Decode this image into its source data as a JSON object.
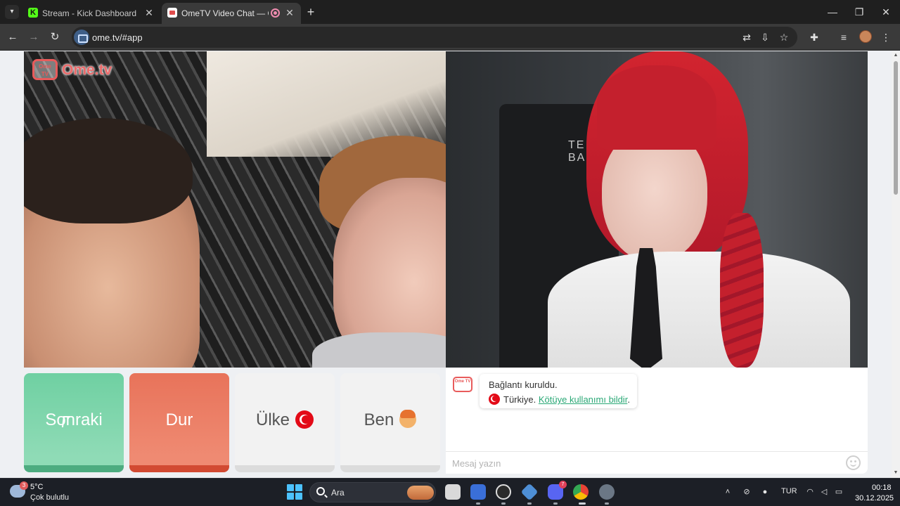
{
  "browser": {
    "tabs": [
      {
        "title": "Stream - Kick Dashboard",
        "favicon": "kick-icon",
        "active": false
      },
      {
        "title": "OmeTV Video Chat — Ome",
        "favicon": "ometv-icon",
        "active": true,
        "recording": true
      }
    ],
    "url": "ome.tv/#app",
    "toolbar_icons": [
      "translate-icon",
      "install-app-icon",
      "bookmark-star-icon",
      "extensions-icon",
      "media-controls-icon",
      "profile-avatar",
      "menu-kebab-icon"
    ]
  },
  "page": {
    "logo": {
      "badge_text": "Ome TV",
      "text": "Ome.tv"
    },
    "remote_chair_text": "TE\nBA",
    "buttons": {
      "next": "Sonraki",
      "stop": "Dur",
      "country": "Ülke",
      "me": "Ben"
    },
    "chat": {
      "logo_text": "Ome TV",
      "message_line1": "Bağlantı kuruldu.",
      "message_country": "Türkiye.",
      "report_link": "Kötüye kullanımı bildir",
      "report_suffix": ".",
      "input_placeholder": "Mesaj yazın",
      "input_value": ""
    },
    "colors": {
      "next_button": "#7dd6ab",
      "stop_button": "#eb7e66",
      "neutral_button": "#f2f2f2",
      "link": "#2aa876",
      "brand": "#e85b5b"
    }
  },
  "taskbar": {
    "weather": {
      "temp": "5°C",
      "desc": "Çok bulutlu",
      "badge": "3"
    },
    "search_label": "Ara",
    "apps": [
      {
        "name": "file-explorer-icon",
        "badge": ""
      },
      {
        "name": "app-blue-icon",
        "badge": ""
      },
      {
        "name": "obs-icon",
        "badge": ""
      },
      {
        "name": "app-diamond-icon",
        "badge": ""
      },
      {
        "name": "discord-icon",
        "badge": "7"
      },
      {
        "name": "chrome-icon",
        "badge": ""
      },
      {
        "name": "settings-icon",
        "badge": ""
      }
    ],
    "language": "TUR",
    "time": "00:18",
    "date": "30.12.2025"
  }
}
